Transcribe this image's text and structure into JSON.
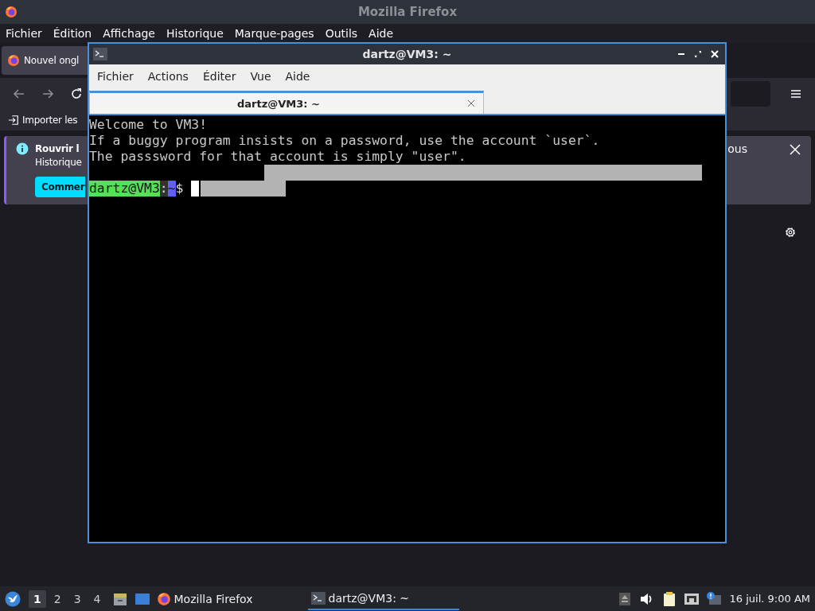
{
  "firefox": {
    "title": "Mozilla Firefox",
    "menu": [
      "Fichier",
      "Édition",
      "Affichage",
      "Historique",
      "Marque-pages",
      "Outils",
      "Aide"
    ],
    "tab": {
      "label": "Nouvel ongl",
      "selected": true
    },
    "bookmark": "Importer les",
    "notification": {
      "title": "Rouvrir l",
      "subtitle": "Historique",
      "button": "Commer",
      "tail": "ous"
    }
  },
  "terminal": {
    "title": "dartz@VM3: ~",
    "menu": [
      "Fichier",
      "Actions",
      "Éditer",
      "Vue",
      "Aide"
    ],
    "tabs": [
      {
        "label": "dartz@VM3: ~",
        "selected": true
      }
    ],
    "lines": [
      "Welcome to VM3!",
      "If a buggy program insists on a password, use the account `user`.",
      "The passsword for that account is simply \"user\"."
    ],
    "prompt": {
      "user_host": "dartz@VM3",
      "separator": ":",
      "path": "~",
      "symbol": "$"
    }
  },
  "taskbar": {
    "workspaces": [
      {
        "label": "1",
        "selected": true
      },
      {
        "label": "2",
        "selected": false
      },
      {
        "label": "3",
        "selected": false
      },
      {
        "label": "4",
        "selected": false
      }
    ],
    "tasks": [
      {
        "kind": "firefox",
        "label": "Mozilla Firefox",
        "selected": false
      },
      {
        "kind": "terminal",
        "label": "dartz@VM3: ~",
        "selected": true
      }
    ],
    "clock": "16 juil. 9:00 AM"
  }
}
